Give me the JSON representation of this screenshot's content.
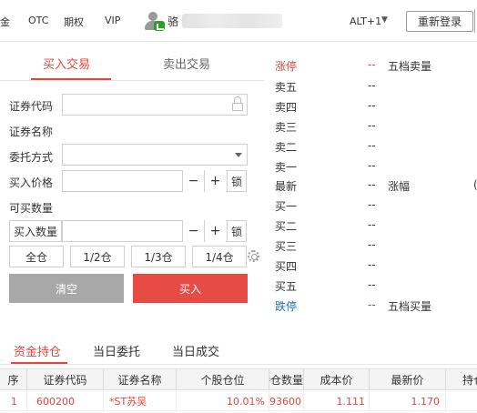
{
  "topbar": {
    "nav": [
      "金",
      "OTC",
      "期权",
      "VIP"
    ],
    "user_name": "骆",
    "alt_label": "ALT+1",
    "alt_arrow": "▼",
    "relogin_label": "重新登录"
  },
  "trade_tabs": {
    "buy": "买入交易",
    "sell": "卖出交易"
  },
  "form": {
    "code_label": "证券代码",
    "code_value": "",
    "name_label": "证券名称",
    "name_value": "",
    "method_label": "委托方式",
    "method_value": "",
    "price_label": "买入价格",
    "price_value": "",
    "available_label": "可买数量",
    "available_value": "",
    "qty_button_label": "买入数量",
    "qty_value": "",
    "minus": "−",
    "plus": "+",
    "lock": "锁",
    "quick": [
      "全仓",
      "1/2仓",
      "1/3仓",
      "1/4仓"
    ],
    "clear_label": "清空",
    "buy_label": "买入"
  },
  "quote": {
    "rows": [
      {
        "label": "涨停",
        "value": "--",
        "right": "五档卖量"
      },
      {
        "label": "卖五",
        "value": "--",
        "right": ""
      },
      {
        "label": "卖四",
        "value": "--",
        "right": ""
      },
      {
        "label": "卖三",
        "value": "--",
        "right": ""
      },
      {
        "label": "卖二",
        "value": "--",
        "right": ""
      },
      {
        "label": "卖一",
        "value": "--",
        "right": ""
      },
      {
        "label": "最新",
        "value": "--",
        "right": "涨幅"
      },
      {
        "label": "买一",
        "value": "--",
        "right": ""
      },
      {
        "label": "买二",
        "value": "--",
        "right": ""
      },
      {
        "label": "买三",
        "value": "--",
        "right": ""
      },
      {
        "label": "买四",
        "value": "--",
        "right": ""
      },
      {
        "label": "买五",
        "value": "--",
        "right": ""
      },
      {
        "label": "跌停",
        "value": "--",
        "right": "五档买量"
      }
    ],
    "edge_mark": "("
  },
  "bottom_tabs": [
    "资金持仓",
    "当日委托",
    "当日成交"
  ],
  "holdings": {
    "columns": [
      "序",
      "证券代码",
      "证券名称",
      "个股仓位",
      "持仓数量",
      "成本价",
      "最新价",
      "持仓"
    ],
    "rows": [
      [
        "1",
        "600200",
        "*ST苏吴",
        "10.01%",
        "93600",
        "1.111",
        "1.170",
        ""
      ]
    ]
  },
  "colors": {
    "accent_red": "#e0473b",
    "buy_button": "#e84a44",
    "clear_button": "#a8a8a8",
    "fall_blue": "#1a73b8"
  }
}
